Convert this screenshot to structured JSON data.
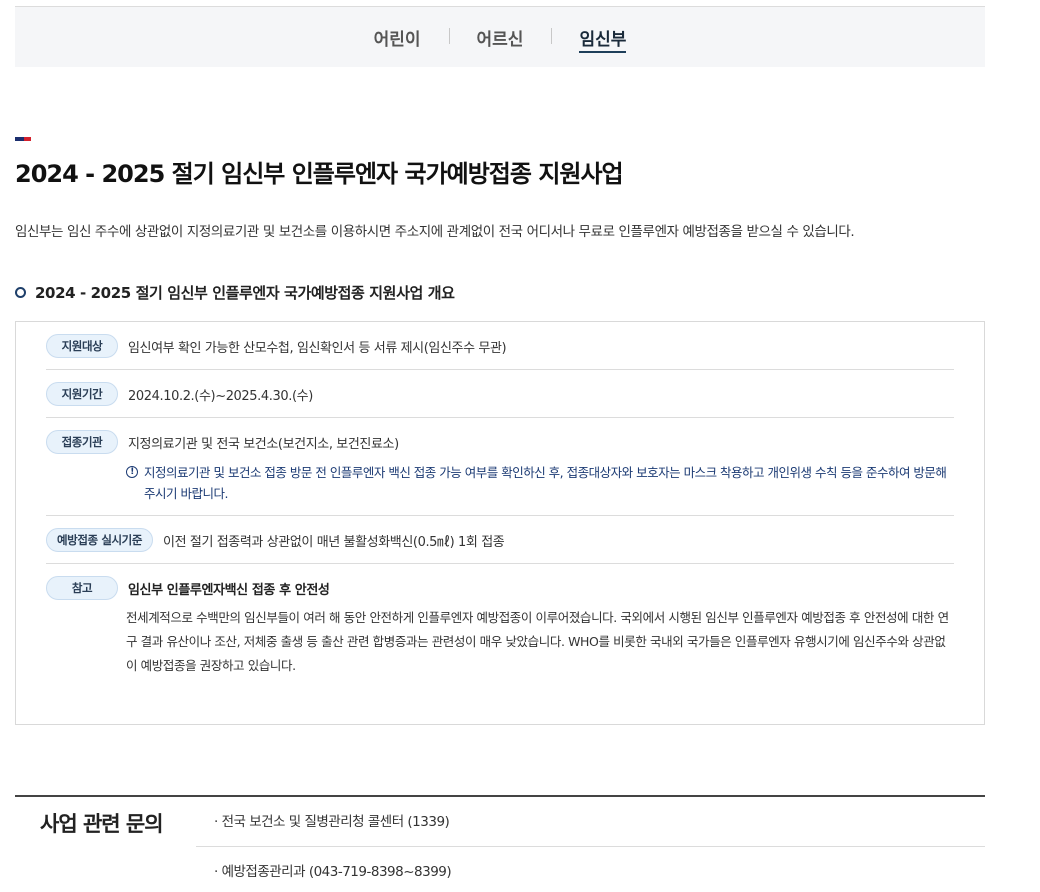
{
  "tabs": [
    {
      "label": "어린이",
      "active": false
    },
    {
      "label": "어르신",
      "active": false
    },
    {
      "label": "임신부",
      "active": true
    }
  ],
  "accent_colors": [
    "#1c2f6e",
    "#d3202c"
  ],
  "page": {
    "title": "2024 - 2025 절기 임신부 인플루엔자 국가예방접종 지원사업",
    "intro": "임신부는 임신 주수에 상관없이 지정의료기관 및 보건소를 이용하시면 주소지에 관계없이 전국 어디서나 무료로 인플루엔자 예방접종을 받으실 수 있습니다."
  },
  "section": {
    "title": "2024 - 2025 절기 임신부 인플루엔자 국가예방접종 지원사업 개요",
    "rows": [
      {
        "badge": "지원대상",
        "text": "임신여부 확인 가능한 산모수첩, 임신확인서 등 서류 제시(임신주수 무관)"
      },
      {
        "badge": "지원기간",
        "text": "2024.10.2.(수)~2025.4.30.(수)"
      },
      {
        "badge": "접종기관",
        "text": "지정의료기관 및 전국 보건소(보건지소, 보건진료소)",
        "notice": "지정의료기관 및 보건소 접종 방문 전 인플루엔자 백신 접종 가능 여부를 확인하신 후, 접종대상자와 보호자는 마스크 착용하고 개인위생 수칙 등을 준수하여 방문해주시기 바랍니다."
      },
      {
        "badge": "예방접종 실시기준",
        "text": "이전 절기 접종력과 상관없이 매년 불활성화백신(0.5㎖) 1회 접종"
      },
      {
        "badge": "참고",
        "text": "임신부 인플루엔자백신 접종 후 안전성",
        "paragraph": "전세계적으로 수백만의 임신부들이 여러 해 동안 안전하게 인플루엔자 예방접종이 이루어졌습니다. 국외에서 시행된 임신부 인플루엔자 예방접종 후 안전성에 대한 연구 결과 유산이나 조산, 저체중 출생 등 출산 관련 합병증과는 관련성이 매우 낮았습니다. WHO를 비롯한 국내외 국가들은 인플루엔자 유행시기에 임신주수와 상관없이 예방접종을 권장하고 있습니다."
      }
    ]
  },
  "contact": {
    "title": "사업 관련 문의",
    "items": [
      "· 전국 보건소 및 질병관리청 콜센터 (1339)",
      "· 예방접종관리과 (043-719-8398~8399)"
    ]
  },
  "icons": {
    "section_bullet": "circle-bullet-icon",
    "notice": "info-circle-icon"
  }
}
